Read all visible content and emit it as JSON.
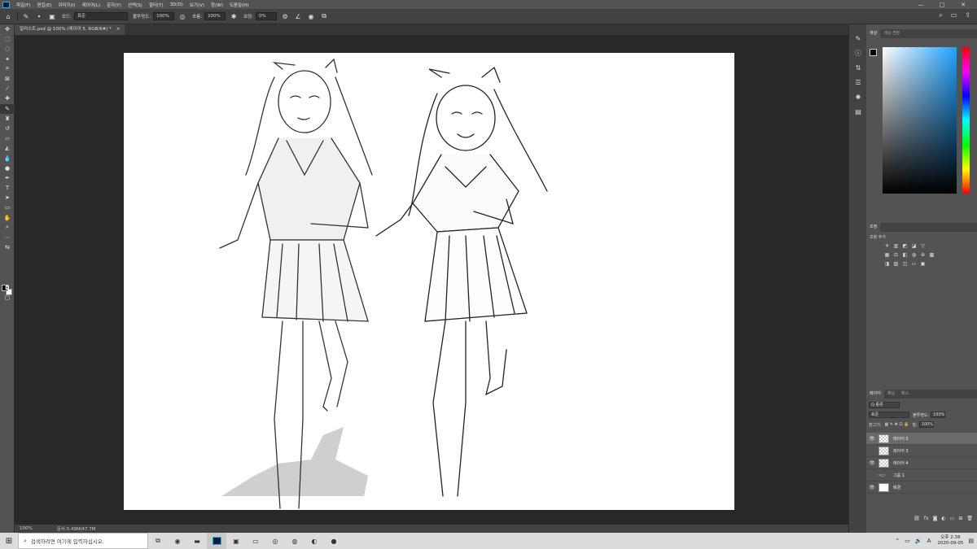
{
  "menu": {
    "items": [
      "파일(F)",
      "편집(E)",
      "이미지(I)",
      "레이어(L)",
      "문자(Y)",
      "선택(S)",
      "필터(T)",
      "3D(D)",
      "보기(V)",
      "창(W)",
      "도움말(H)"
    ],
    "window_controls": [
      "—",
      "□",
      "✕"
    ]
  },
  "options": {
    "mode_label": "모드:",
    "mode_value": "표준",
    "opacity_label": "불투명도:",
    "opacity_value": "100%",
    "flow_label": "흐름:",
    "flow_value": "100%",
    "smoothing_label": "보정:",
    "smoothing_value": "0%"
  },
  "document": {
    "tab_title": "일러스트.psd @ 100% (레이어 5, RGB/8#) *",
    "close": "×"
  },
  "status": {
    "zoom": "100%",
    "doc_size": "문서:5.49M/47.7M"
  },
  "panels": {
    "color_tabs": [
      "색상",
      "색상 견본"
    ],
    "adjust_tabs": [
      "조정"
    ],
    "adjust_add": "조정 추가",
    "layers_tabs": [
      "레이어",
      "채널",
      "패스"
    ],
    "kind_filter": "Q 종류",
    "blend_mode": "표준",
    "opacity_label": "불투명도:",
    "opacity_value": "100%",
    "lock_label": "잠그기:",
    "fill_label": "칠:",
    "fill_value": "100%",
    "layers": [
      {
        "name": "레이어 5",
        "visible": true,
        "selected": true,
        "type": "layer"
      },
      {
        "name": "레이어 3",
        "visible": false,
        "selected": false,
        "type": "layer"
      },
      {
        "name": "레이어 4",
        "visible": true,
        "selected": false,
        "type": "layer"
      },
      {
        "name": "그룹 1",
        "visible": false,
        "selected": false,
        "type": "group"
      },
      {
        "name": "배경",
        "visible": true,
        "selected": false,
        "type": "background"
      }
    ]
  },
  "taskbar": {
    "search_placeholder": "검색하려면 여기에 입력하십시오.",
    "time": "오후 2:39",
    "date": "2020-09-05"
  },
  "colors": {
    "ui_dark": "#535353",
    "canvas": "#ffffff",
    "ps_blue": "#31a8ff"
  }
}
